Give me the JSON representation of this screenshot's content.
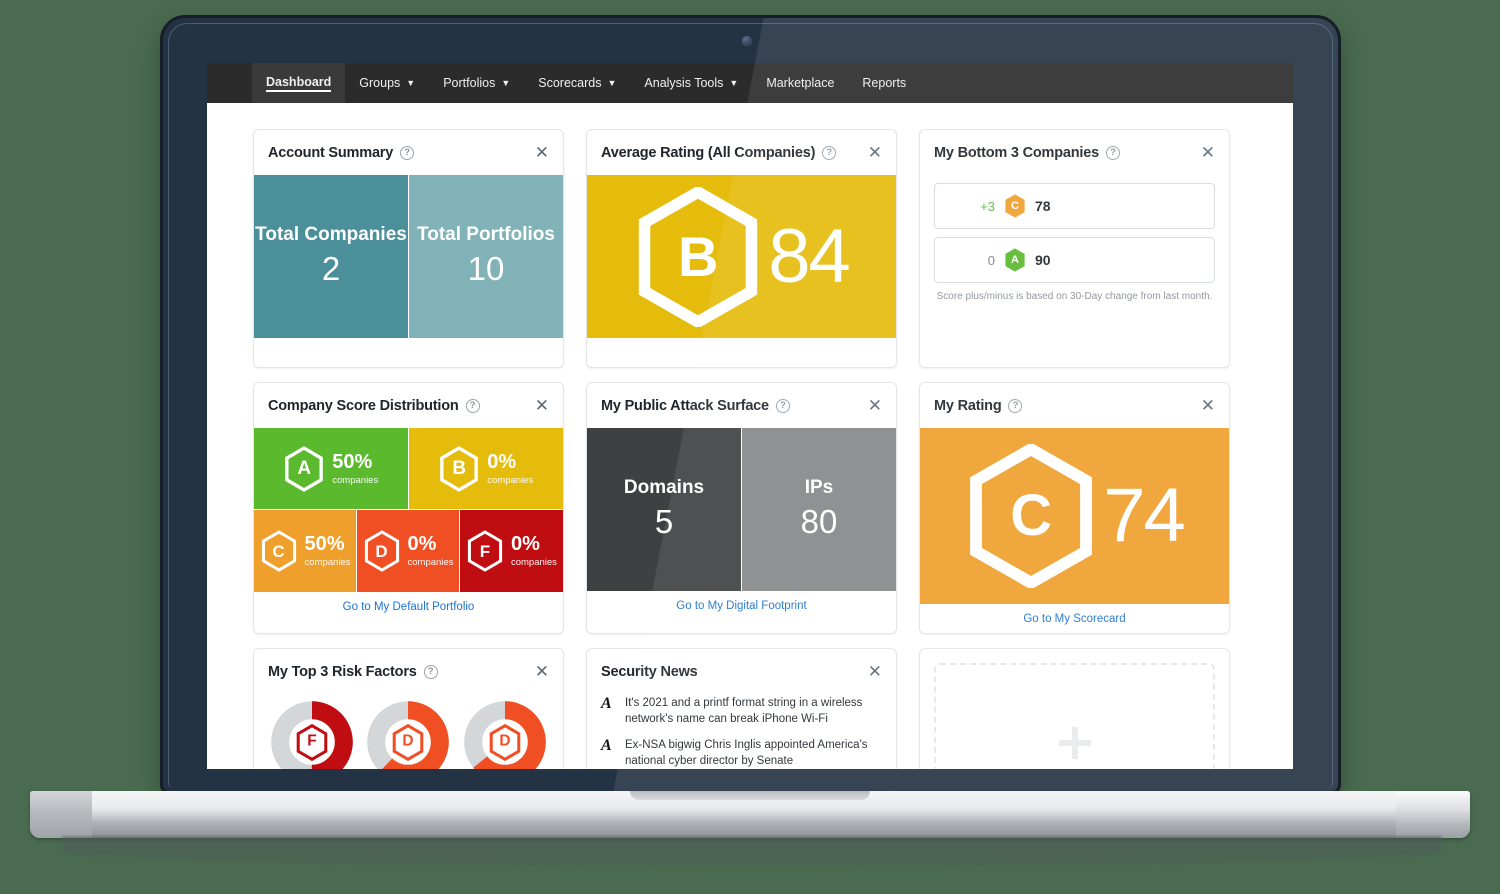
{
  "nav": {
    "items": [
      {
        "label": "Dashboard",
        "has_caret": false,
        "active": true
      },
      {
        "label": "Groups",
        "has_caret": true,
        "active": false
      },
      {
        "label": "Portfolios",
        "has_caret": true,
        "active": false
      },
      {
        "label": "Scorecards",
        "has_caret": true,
        "active": false
      },
      {
        "label": "Analysis Tools",
        "has_caret": true,
        "active": false
      },
      {
        "label": "Marketplace",
        "has_caret": false,
        "active": false
      },
      {
        "label": "Reports",
        "has_caret": false,
        "active": false
      }
    ],
    "caret_glyph": "▼"
  },
  "icons": {
    "help": "?",
    "close": "✕",
    "news_logo": "A"
  },
  "cards": {
    "account_summary": {
      "title": "Account Summary",
      "tiles": [
        {
          "label": "Total Companies",
          "value": "2"
        },
        {
          "label": "Total Portfolios",
          "value": "10"
        }
      ]
    },
    "average_rating": {
      "title": "Average Rating (All Companies)",
      "grade": "B",
      "score": "84",
      "color": "#e5bc0b"
    },
    "bottom_companies": {
      "title": "My Bottom 3 Companies",
      "rows": [
        {
          "delta": "+3",
          "delta_dir": "up",
          "grade": "C",
          "score": "78",
          "color": "#ef9f2c"
        },
        {
          "delta": "0",
          "delta_dir": "flat",
          "grade": "A",
          "score": "90",
          "color": "#5ab92c"
        }
      ],
      "note": "Score plus/minus is based on 30-Day change from last month."
    },
    "score_distribution": {
      "title": "Company Score Distribution",
      "unit": "companies",
      "cells": [
        {
          "grade": "A",
          "pct": "50%",
          "color": "#5ab92c"
        },
        {
          "grade": "B",
          "pct": "0%",
          "color": "#e5bc0b"
        },
        {
          "grade": "C",
          "pct": "50%",
          "color": "#ef9f2c"
        },
        {
          "grade": "D",
          "pct": "0%",
          "color": "#f04e23"
        },
        {
          "grade": "F",
          "pct": "0%",
          "color": "#bf0d12"
        }
      ],
      "footer_link": "Go to My Default Portfolio"
    },
    "attack_surface": {
      "title": "My Public Attack Surface",
      "tiles": [
        {
          "label": "Domains",
          "value": "5"
        },
        {
          "label": "IPs",
          "value": "80"
        }
      ],
      "footer_link": "Go to My Digital Footprint"
    },
    "my_rating": {
      "title": "My Rating",
      "grade": "C",
      "score": "74",
      "color": "#ef9f2c",
      "footer_link": "Go to My Scorecard"
    },
    "risk_factors": {
      "title": "My Top 3 Risk Factors",
      "donuts": [
        {
          "grade": "F",
          "percent": 50,
          "color": "#bf0d12"
        },
        {
          "grade": "D",
          "percent": 62,
          "color": "#f04e23"
        },
        {
          "grade": "D",
          "percent": 64,
          "color": "#f04e23"
        }
      ]
    },
    "security_news": {
      "title": "Security News",
      "items": [
        "It's 2021 and a printf format string in a wireless network's name can break iPhone Wi-Fi",
        "Ex-NSA bigwig Chris Inglis appointed America's national cyber director by Senate"
      ]
    },
    "add_widget": {
      "title": ""
    }
  }
}
